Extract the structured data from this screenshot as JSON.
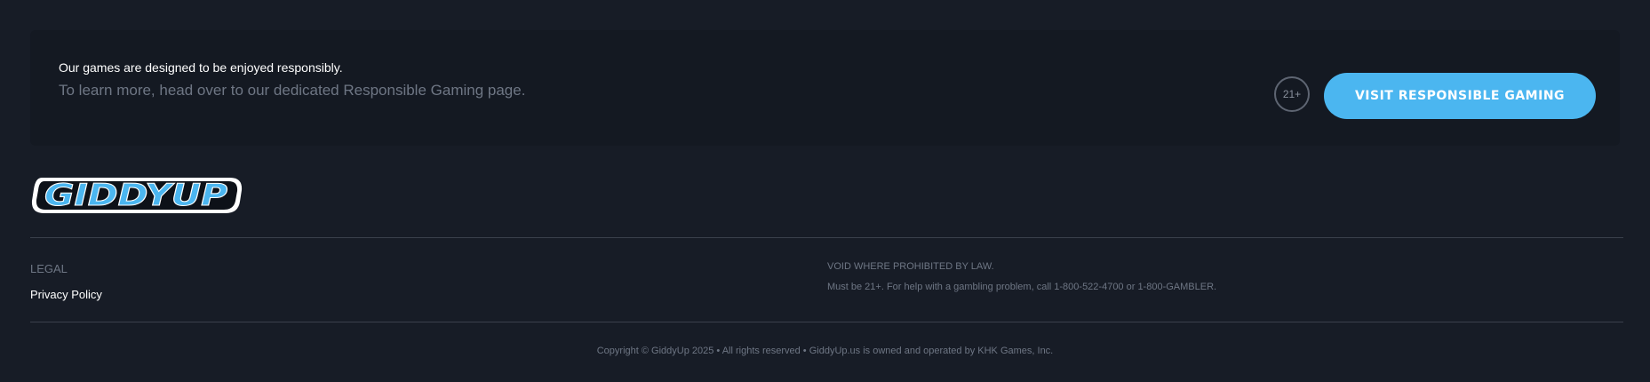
{
  "responsible_gaming": {
    "line1": "Our games are designed to be enjoyed responsibly.",
    "line2": "To learn more, head over to our dedicated Responsible Gaming page.",
    "age_badge": "21+",
    "button_label": "VISIT RESPONSIBLE GAMING"
  },
  "brand": {
    "logo_text": "GIDDYUP",
    "logo_color": "#4bb6f0",
    "accent": "#4bb6f0"
  },
  "footer": {
    "legal_heading": "LEGAL",
    "privacy_link": "Privacy Policy",
    "void_text": "VOID WHERE PROHIBITED BY LAW.",
    "age_help": "Must be 21+. For help with a gambling problem, call 1-800-522-4700 or 1-800-GAMBLER.",
    "copyright": "Copyright © GiddyUp 2025 • All rights reserved • GiddyUp.us is owned and operated by KHK Games, Inc."
  }
}
